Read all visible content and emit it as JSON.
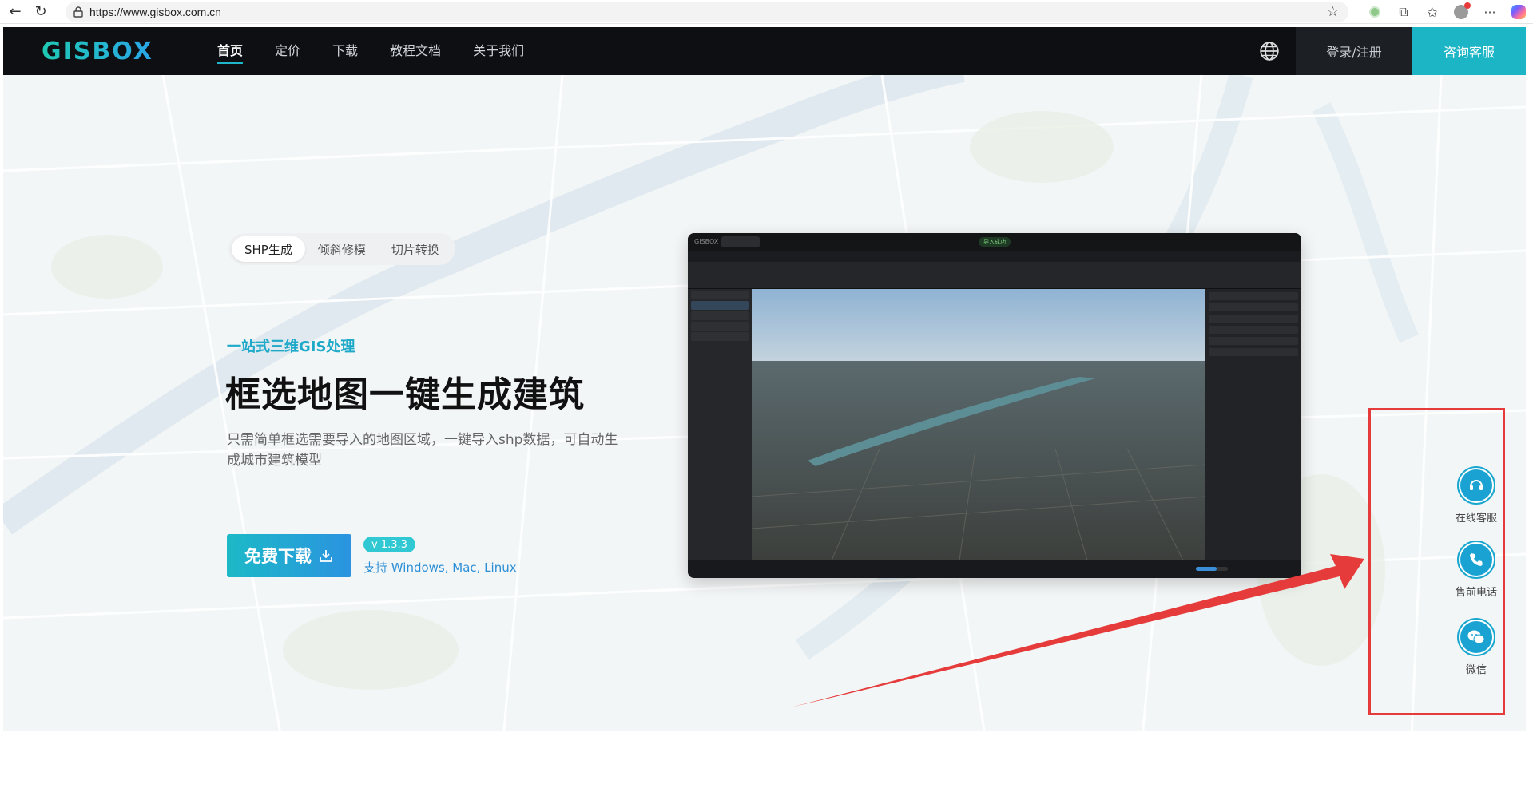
{
  "browser": {
    "url": "https://www.gisbox.com.cn"
  },
  "header": {
    "logo": "GISBOX",
    "nav": [
      "首页",
      "定价",
      "下载",
      "教程文档",
      "关于我们"
    ],
    "login_label": "登录/注册",
    "consult_label": "咨询客服"
  },
  "hero": {
    "tabs": [
      "SHP生成",
      "倾斜修模",
      "切片转换"
    ],
    "eyebrow": "一站式三维GIS处理",
    "headline": "框选地图一键生成建筑",
    "description": "只需简单框选需要导入的地图区域，一键导入shp数据，可自动生成城市建筑模型",
    "download_label": "免费下载",
    "version": "v 1.3.3",
    "platforms": "支持 Windows, Mac, Linux"
  },
  "app_shot": {
    "title": "GISBOX",
    "status": "导入成功"
  },
  "side_widget": {
    "items": [
      "在线客服",
      "售前电话",
      "微信"
    ]
  },
  "colors": {
    "accent": "#1cb5c6",
    "header_bg": "#0d0f12",
    "annotation": "#e63b3b"
  }
}
